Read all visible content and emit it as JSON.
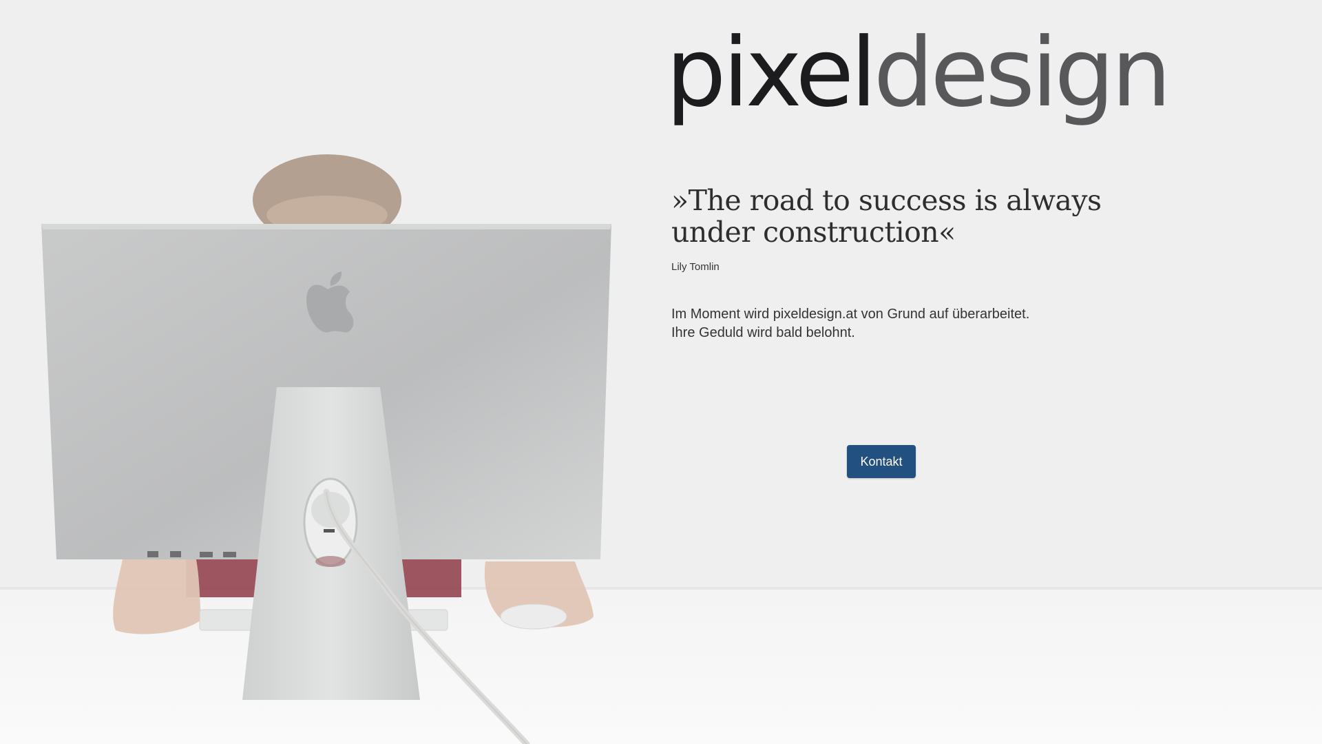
{
  "brand": {
    "logo_part1": "pixel",
    "logo_part2": "design"
  },
  "hero": {
    "quote": "»The road to success is always under construction«",
    "author": "Lily Tomlin",
    "notice_line1": "Im Moment wird pixeldesign.at von Grund auf überarbeitet.",
    "notice_line2": "Ihre Geduld wird bald belohnt."
  },
  "actions": {
    "contact_label": "Kontakt"
  },
  "colors": {
    "background": "#efefef",
    "button": "#22507f",
    "logo_dark": "#1c1c1e",
    "logo_gray": "#58585a"
  },
  "illustration": {
    "subject": "person-behind-monitor",
    "icon": "apple-logo-icon"
  }
}
